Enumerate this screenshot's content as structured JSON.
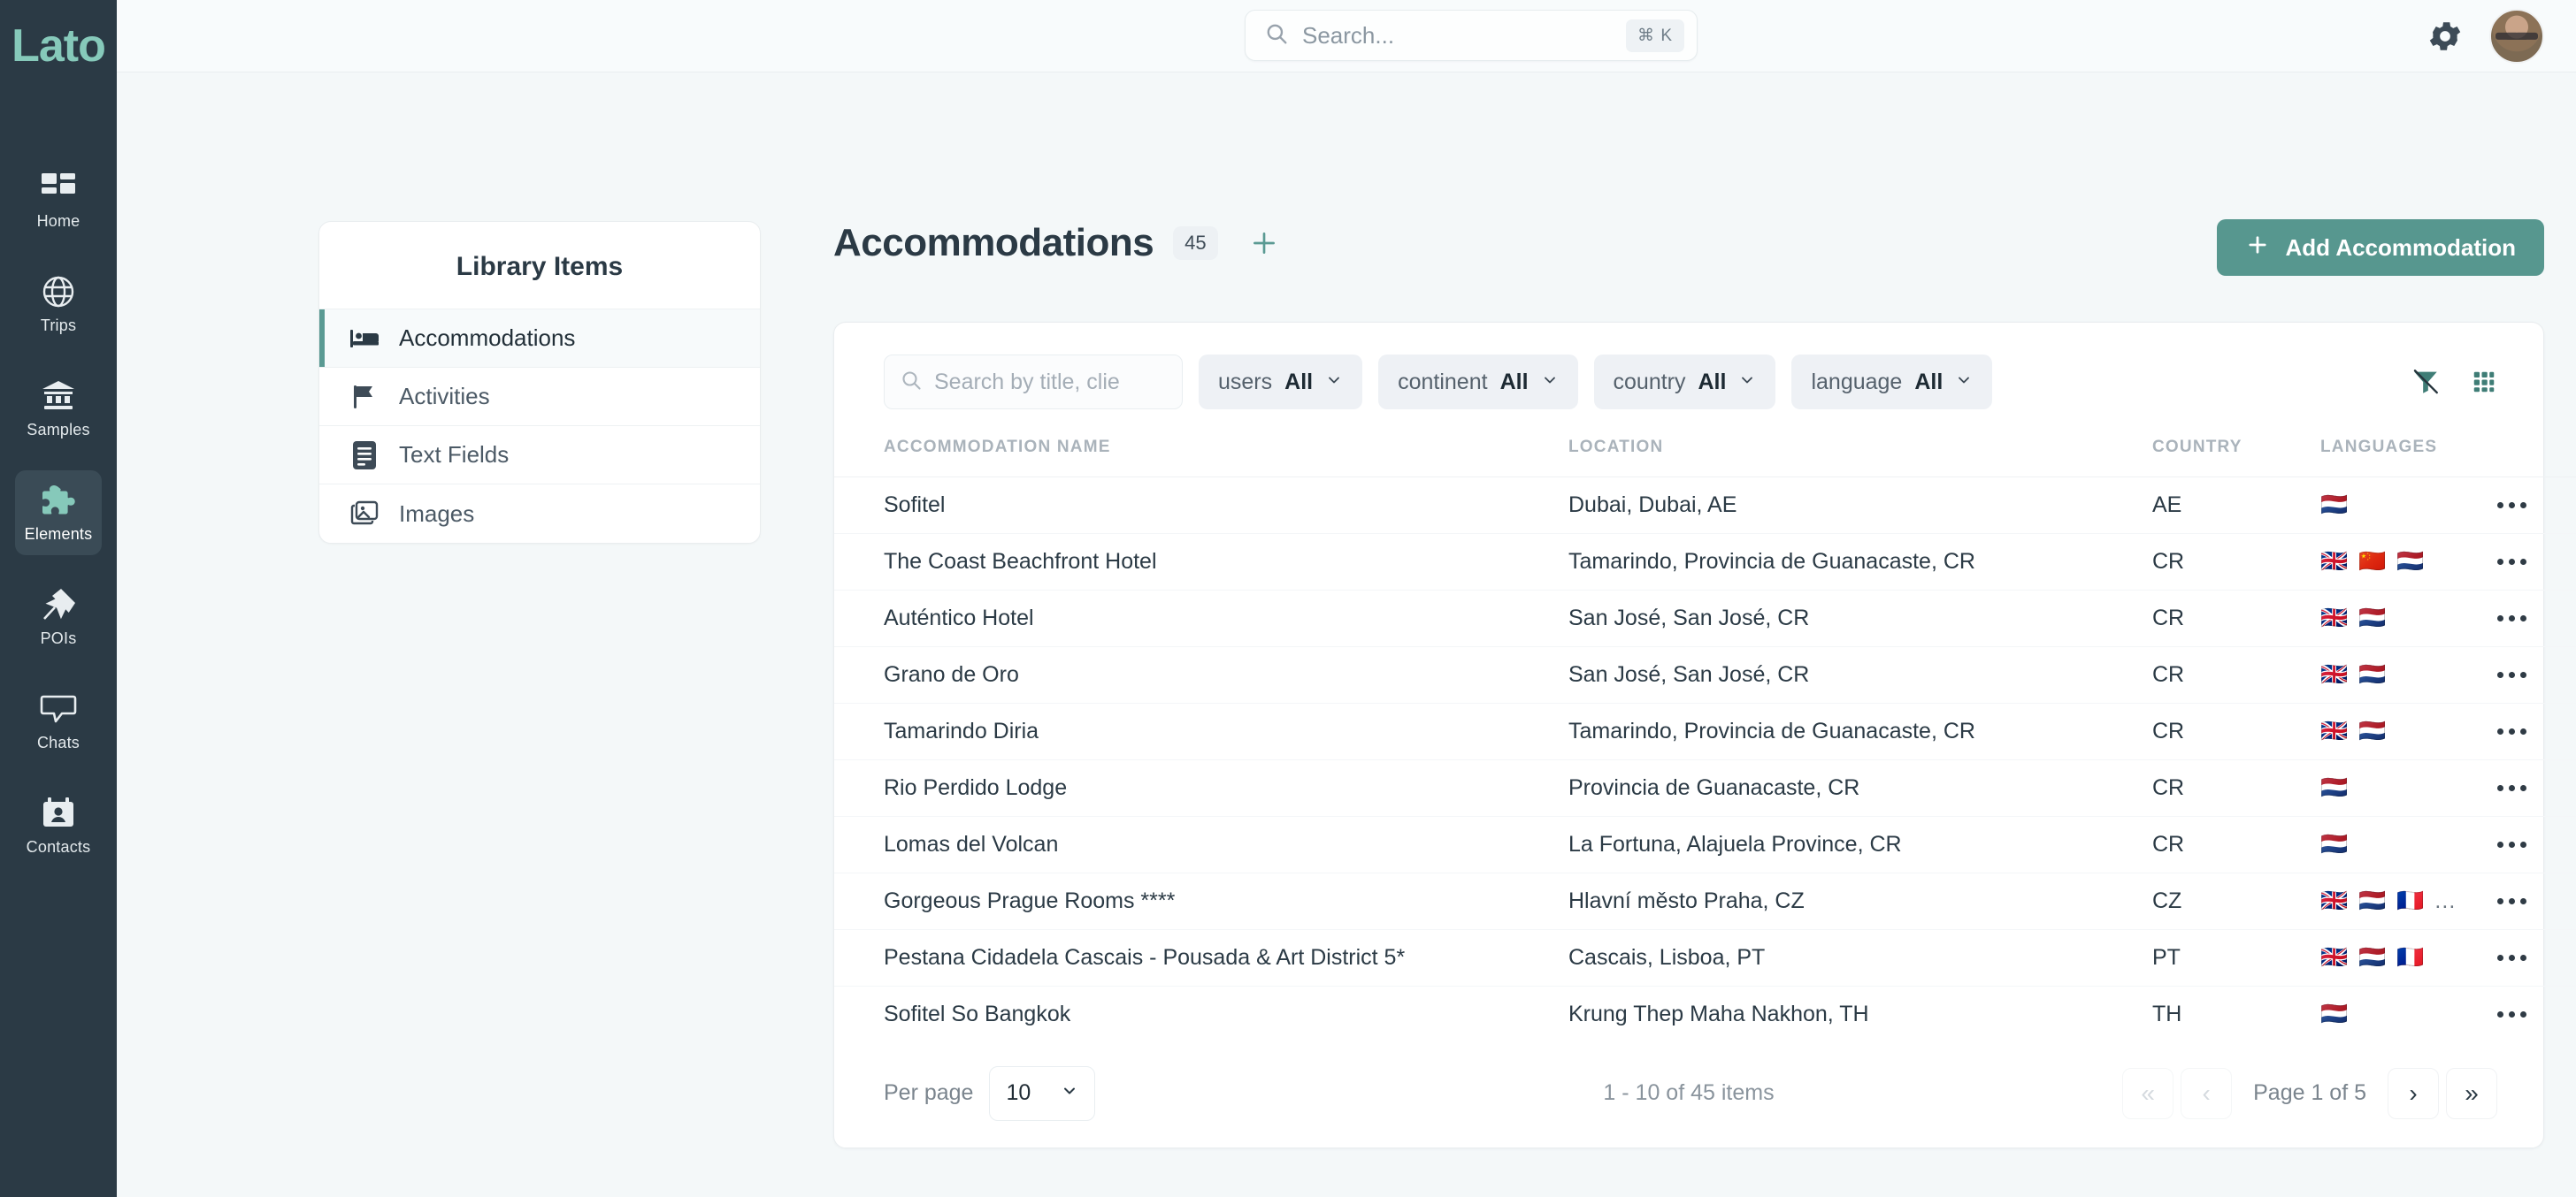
{
  "brand": {
    "logo_text": "Lato",
    "accent": "#86c9ba",
    "rail_bg": "#2b3a45",
    "button_green": "#57978f"
  },
  "rail": {
    "items": [
      {
        "label": "Home",
        "icon": "dashboard-icon"
      },
      {
        "label": "Trips",
        "icon": "globe-icon"
      },
      {
        "label": "Samples",
        "icon": "bank-icon"
      },
      {
        "label": "Elements",
        "icon": "puzzle-icon"
      },
      {
        "label": "POIs",
        "icon": "pin-icon"
      },
      {
        "label": "Chats",
        "icon": "chat-bubble-icon"
      },
      {
        "label": "Contacts",
        "icon": "contacts-icon"
      }
    ],
    "active_index": 3
  },
  "topbar": {
    "search_placeholder": "Search...",
    "search_value": "",
    "shortcut": "⌘ K",
    "gear_icon": "gear-icon",
    "avatar_icon": "avatar"
  },
  "library": {
    "title": "Library Items",
    "items": [
      {
        "label": "Accommodations",
        "icon": "bed-icon"
      },
      {
        "label": "Activities",
        "icon": "flag-icon"
      },
      {
        "label": "Text Fields",
        "icon": "document-icon"
      },
      {
        "label": "Images",
        "icon": "image-icon"
      }
    ],
    "active_index": 0
  },
  "page": {
    "title": "Accommodations",
    "count": "45",
    "add_tab_icon": "plus-icon",
    "add_button": "Add Accommodation",
    "add_button_icon": "plus-icon"
  },
  "filters": {
    "search_placeholder": "Search by title, clie",
    "search_value": "",
    "search_icon": "search-icon",
    "chips": [
      {
        "label": "users",
        "value": "All"
      },
      {
        "label": "continent",
        "value": "All"
      },
      {
        "label": "country",
        "value": "All"
      },
      {
        "label": "language",
        "value": "All"
      }
    ],
    "clear_filter_icon": "filter-off-icon",
    "columns_icon": "grid-columns-icon"
  },
  "table": {
    "columns": [
      "ACCOMMODATION NAME",
      "LOCATION",
      "COUNTRY",
      "LANGUAGES"
    ],
    "row_menu_icon": "more-horizontal-icon",
    "rows": [
      {
        "name": "Sofitel",
        "location": "Dubai, Dubai, AE",
        "country": "AE",
        "languages": [
          "🇳🇱"
        ],
        "more": false
      },
      {
        "name": "The Coast Beachfront Hotel",
        "location": "Tamarindo, Provincia de Guanacaste, CR",
        "country": "CR",
        "languages": [
          "🇬🇧",
          "🇨🇳",
          "🇳🇱"
        ],
        "more": false
      },
      {
        "name": "Auténtico Hotel",
        "location": "San José, San José, CR",
        "country": "CR",
        "languages": [
          "🇬🇧",
          "🇳🇱"
        ],
        "more": false
      },
      {
        "name": "Grano de Oro",
        "location": "San José, San José, CR",
        "country": "CR",
        "languages": [
          "🇬🇧",
          "🇳🇱"
        ],
        "more": false
      },
      {
        "name": "Tamarindo Diria",
        "location": "Tamarindo, Provincia de Guanacaste, CR",
        "country": "CR",
        "languages": [
          "🇬🇧",
          "🇳🇱"
        ],
        "more": false
      },
      {
        "name": "Rio Perdido Lodge",
        "location": "Provincia de Guanacaste, CR",
        "country": "CR",
        "languages": [
          "🇳🇱"
        ],
        "more": false
      },
      {
        "name": "Lomas del Volcan",
        "location": "La Fortuna, Alajuela Province, CR",
        "country": "CR",
        "languages": [
          "🇳🇱"
        ],
        "more": false
      },
      {
        "name": "Gorgeous Prague Rooms ****",
        "location": "Hlavní město Praha, CZ",
        "country": "CZ",
        "languages": [
          "🇬🇧",
          "🇳🇱",
          "🇫🇷"
        ],
        "more": true,
        "more_text": "..."
      },
      {
        "name": "Pestana Cidadela Cascais - Pousada & Art District 5*",
        "location": "Cascais, Lisboa, PT",
        "country": "PT",
        "languages": [
          "🇬🇧",
          "🇳🇱",
          "🇫🇷"
        ],
        "more": false
      },
      {
        "name": "Sofitel So Bangkok",
        "location": "Krung Thep Maha Nakhon, TH",
        "country": "TH",
        "languages": [
          "🇳🇱"
        ],
        "more": false
      }
    ]
  },
  "footer": {
    "per_page_label": "Per page",
    "per_page_value": "10",
    "items_count": "1 - 10 of 45 items",
    "page_text": "Page 1 of 5",
    "first_label": "«",
    "prev_label": "‹",
    "next_label": "›",
    "last_label": "»"
  }
}
